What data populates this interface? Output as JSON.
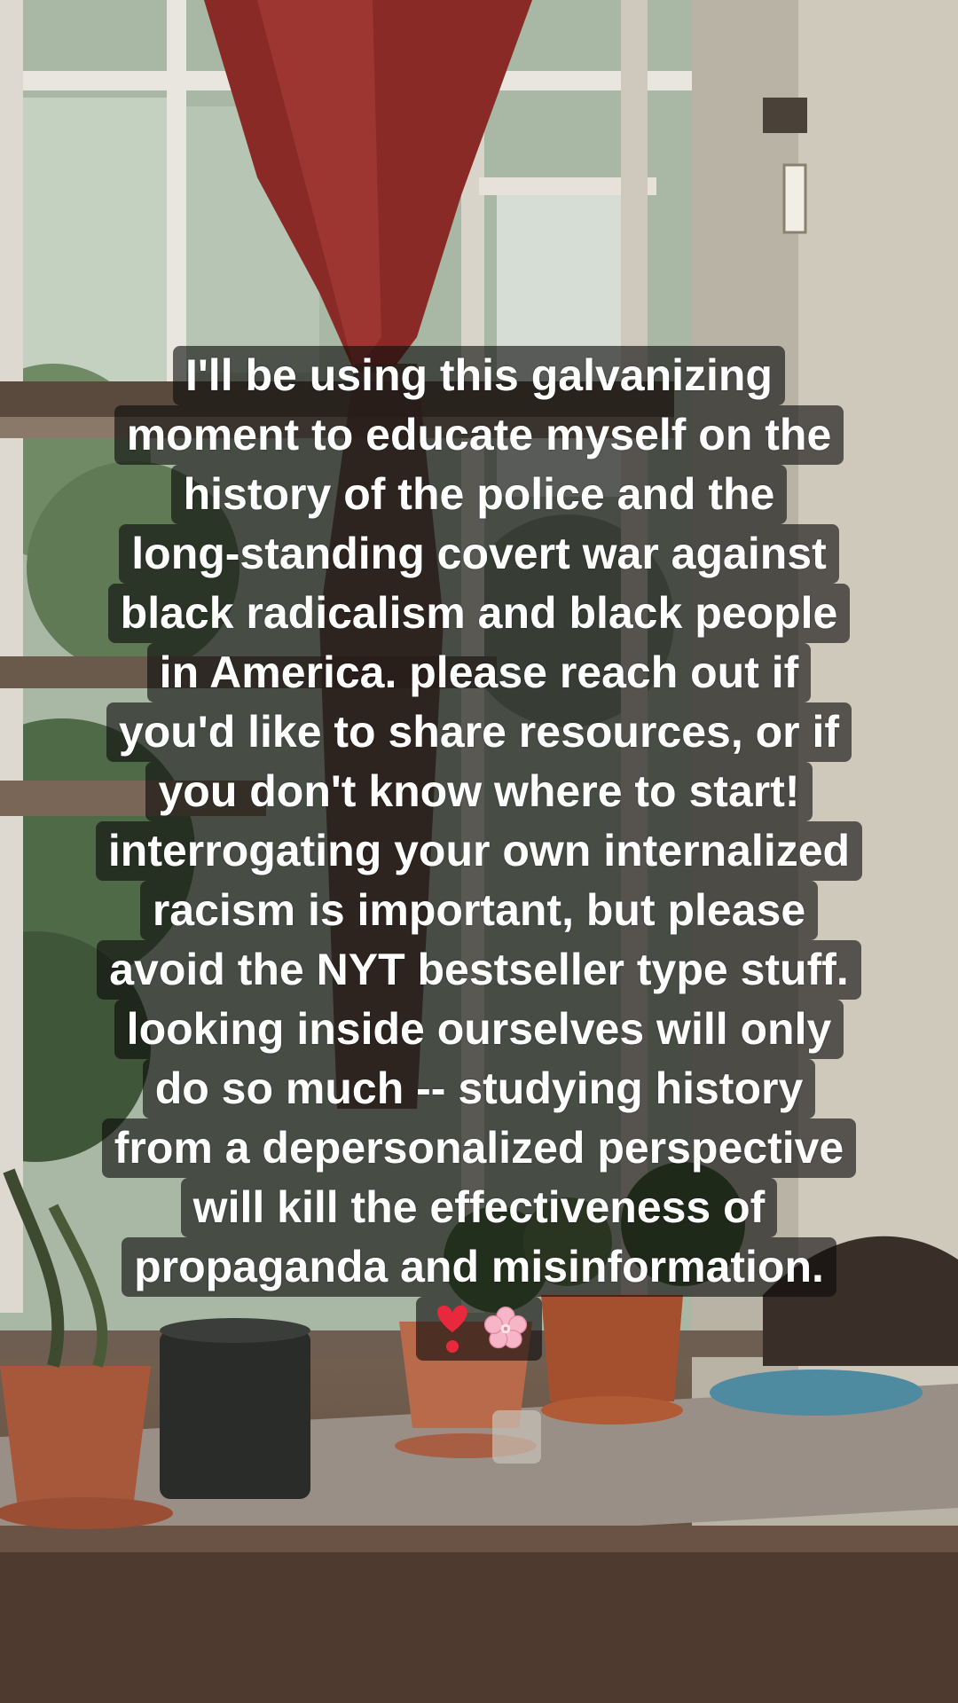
{
  "caption": {
    "lines": [
      "I'll be using this galvanizing",
      "moment to educate myself on the",
      "history of the police and the",
      "long-standing covert war against",
      "black radicalism and black people",
      "in America. please reach out if",
      "you'd like to share resources, or if",
      "you don't know where to start!",
      "interrogating your own internalized",
      "racism is important, but please",
      "avoid the NYT bestseller type stuff.",
      "looking inside ourselves will only",
      "do so much -- studying history",
      "from a depersonalized perspective",
      "will kill the effectiveness of",
      "propaganda and misinformation."
    ],
    "emojis": [
      "heavy-heart-exclamation-icon",
      "cherry-blossom-icon"
    ]
  },
  "colors": {
    "text": "#ffffff",
    "caption_background": "rgba(12,12,12,0.62)",
    "heart": "#e8283c",
    "blossom": "#f7b6c8"
  }
}
